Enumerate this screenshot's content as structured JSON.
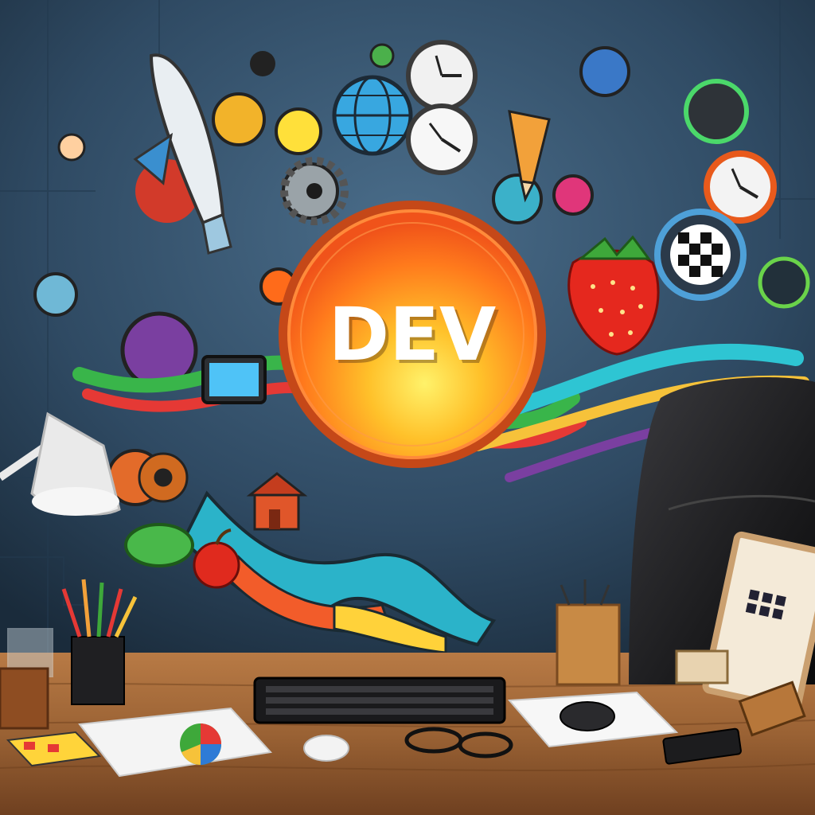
{
  "scene": {
    "headline": "DEV",
    "colors": {
      "wall": "#2f4a63",
      "circle_outer": "#ff6a1a",
      "circle_inner": "#ffcf2e",
      "headline": "#ffffff",
      "desk": "#9a6234",
      "chair": "#1c1c1e"
    },
    "objects": [
      "rocket-icon",
      "clock-icon",
      "globe-icon",
      "gear-icon",
      "strawberry-icon",
      "checkered-badge-icon",
      "monitor-icon",
      "house-icon",
      "apple-icon",
      "desk-lamp",
      "pencil-cup",
      "keyboard",
      "mouse",
      "glasses",
      "papers",
      "office-chair",
      "calculator",
      "framed-sign"
    ]
  }
}
